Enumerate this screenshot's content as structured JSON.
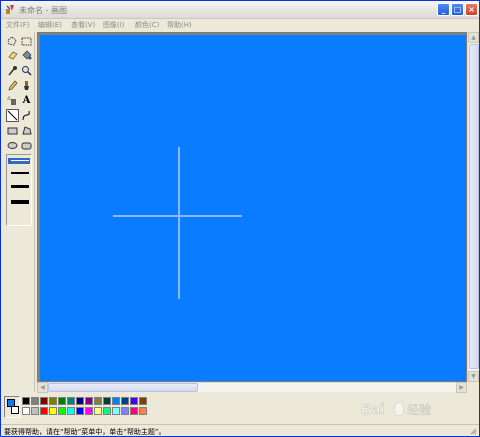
{
  "window": {
    "title": "未命名 - 画图",
    "buttons": {
      "minimize": "_",
      "maximize": "□",
      "close": "×"
    }
  },
  "menu": [
    "文件(F)",
    "编辑(E)",
    "查看(V)",
    "图像(I)",
    "颜色(C)",
    "帮助(H)"
  ],
  "toolbox": {
    "tools": [
      "free-select",
      "rect-select",
      "eraser",
      "fill",
      "color-picker",
      "magnifier",
      "pencil",
      "brush",
      "airbrush",
      "text",
      "line",
      "curve",
      "rectangle",
      "polygon",
      "ellipse",
      "rounded-rectangle"
    ],
    "selected": "line",
    "line_widths": [
      1,
      2,
      3,
      4
    ]
  },
  "canvas": {
    "fill_color": "#0a7cff",
    "line_color": "#8ab8ff"
  },
  "colors": {
    "foreground": "#0a7cff",
    "background": "#ffffff",
    "palette_top": [
      "#000000",
      "#808080",
      "#800000",
      "#808000",
      "#008000",
      "#008080",
      "#000080",
      "#800080",
      "#808040",
      "#004040",
      "#0080ff",
      "#004080",
      "#4000ff",
      "#804000"
    ],
    "palette_bottom": [
      "#ffffff",
      "#c0c0c0",
      "#ff0000",
      "#ffff00",
      "#00ff00",
      "#00ffff",
      "#0000ff",
      "#ff00ff",
      "#ffff80",
      "#00ff80",
      "#80ffff",
      "#8080ff",
      "#ff0080",
      "#ff8040"
    ]
  },
  "statusbar": {
    "text": "要获得帮助，请在“帮助”菜单中，单击“帮助主题”。"
  },
  "watermark": {
    "text": "Bai 经验"
  }
}
